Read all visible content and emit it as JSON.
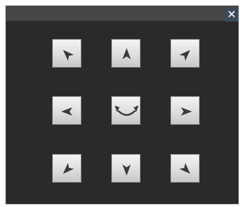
{
  "window": {
    "close_icon": "close-icon",
    "close_glyph": "✕",
    "accent": "#3b4a5a",
    "background": "#2a2a2a",
    "titlebar_color": "#474747"
  },
  "pad": {
    "buttons": [
      {
        "name": "pan-up-left-button",
        "icon": "arrow-up-left-icon"
      },
      {
        "name": "pan-up-button",
        "icon": "arrow-up-icon"
      },
      {
        "name": "pan-up-right-button",
        "icon": "arrow-up-right-icon"
      },
      {
        "name": "pan-left-button",
        "icon": "arrow-left-icon"
      },
      {
        "name": "home-button",
        "icon": "swap-arrows-icon"
      },
      {
        "name": "pan-right-button",
        "icon": "arrow-right-icon"
      },
      {
        "name": "pan-down-left-button",
        "icon": "arrow-down-left-icon"
      },
      {
        "name": "pan-down-button",
        "icon": "arrow-down-icon"
      },
      {
        "name": "pan-down-right-button",
        "icon": "arrow-down-right-icon"
      }
    ],
    "arrow_color": "#3a3a3a"
  }
}
